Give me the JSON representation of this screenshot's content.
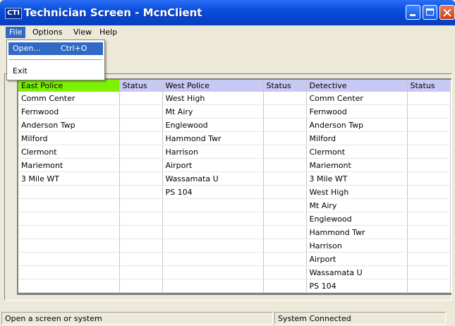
{
  "window": {
    "title": "Technician Screen - McnClient",
    "app_icon": "CTI"
  },
  "menu": {
    "file": "File",
    "options": "Options",
    "view": "View",
    "help": "Help"
  },
  "file_menu": {
    "open_label": "Open...",
    "open_shortcut": "Ctrl+O",
    "exit_label": "Exit"
  },
  "grid": {
    "headers": [
      "East Police",
      "Status",
      "West Police",
      "Status",
      "Detective",
      "Status"
    ],
    "rows": [
      [
        "Comm Center",
        "",
        "West High",
        "",
        "Comm Center",
        ""
      ],
      [
        "Fernwood",
        "",
        "Mt Airy",
        "",
        "Fernwood",
        ""
      ],
      [
        "Anderson Twp",
        "",
        "Englewood",
        "",
        "Anderson Twp",
        ""
      ],
      [
        "Milford",
        "",
        "Hammond Twr",
        "",
        "Milford",
        ""
      ],
      [
        "Clermont",
        "",
        "Harrison",
        "",
        "Clermont",
        ""
      ],
      [
        "Mariemont",
        "",
        "Airport",
        "",
        "Mariemont",
        ""
      ],
      [
        "3 Mile WT",
        "",
        "Wassamata U",
        "",
        "3 Mile WT",
        ""
      ],
      [
        "",
        "",
        "PS 104",
        "",
        "West High",
        ""
      ],
      [
        "",
        "",
        "",
        "",
        "Mt Airy",
        ""
      ],
      [
        "",
        "",
        "",
        "",
        "Englewood",
        ""
      ],
      [
        "",
        "",
        "",
        "",
        "Hammond Twr",
        ""
      ],
      [
        "",
        "",
        "",
        "",
        "Harrison",
        ""
      ],
      [
        "",
        "",
        "",
        "",
        "Airport",
        ""
      ],
      [
        "",
        "",
        "",
        "",
        "Wassamata U",
        ""
      ],
      [
        "",
        "",
        "",
        "",
        "PS 104",
        ""
      ]
    ]
  },
  "status": {
    "left": "Open a screen or system",
    "right": "System Connected"
  },
  "colors": {
    "east_header": "#7cf200",
    "other_header": "#c8c8f4",
    "menu_highlight": "#316ac5"
  }
}
